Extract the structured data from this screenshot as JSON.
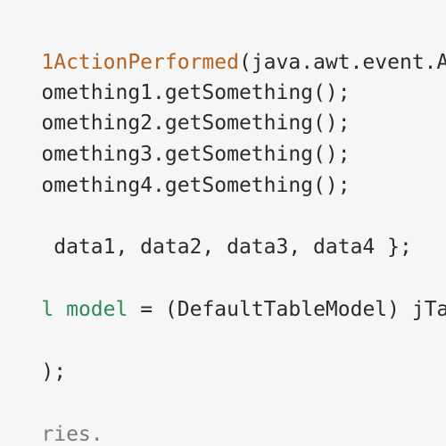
{
  "editor": {
    "lines": [
      {
        "segments": [
          {
            "type": "method",
            "text": "1ActionPerformed"
          },
          {
            "type": "plain",
            "text": "(java.awt.event.A"
          }
        ]
      },
      {
        "segments": [
          {
            "type": "plain",
            "text": "omething1.getSomething();"
          }
        ]
      },
      {
        "segments": [
          {
            "type": "plain",
            "text": "omething2.getSomething();"
          }
        ]
      },
      {
        "segments": [
          {
            "type": "plain",
            "text": "omething3.getSomething();"
          }
        ]
      },
      {
        "segments": [
          {
            "type": "plain",
            "text": "omething4.getSomething();"
          }
        ]
      },
      {
        "segments": [
          {
            "type": "plain",
            "text": " data1, data2, data3, data4 };"
          }
        ]
      },
      {
        "segments": [
          {
            "type": "keyword",
            "text": "l"
          },
          {
            "type": "plain",
            "text": " "
          },
          {
            "type": "keyword",
            "text": "model"
          },
          {
            "type": "plain",
            "text": " = (DefaultTableModel) jTa"
          }
        ]
      },
      {
        "segments": [
          {
            "type": "plain",
            "text": ");"
          }
        ]
      },
      {
        "segments": [
          {
            "type": "comment",
            "text": "ries."
          }
        ]
      }
    ],
    "colors": {
      "background": "#f6f6f6",
      "text": "#2b2b2b",
      "method": "#b4621c",
      "keyword": "#2e8b57",
      "comment": "#7a7a7a"
    }
  }
}
